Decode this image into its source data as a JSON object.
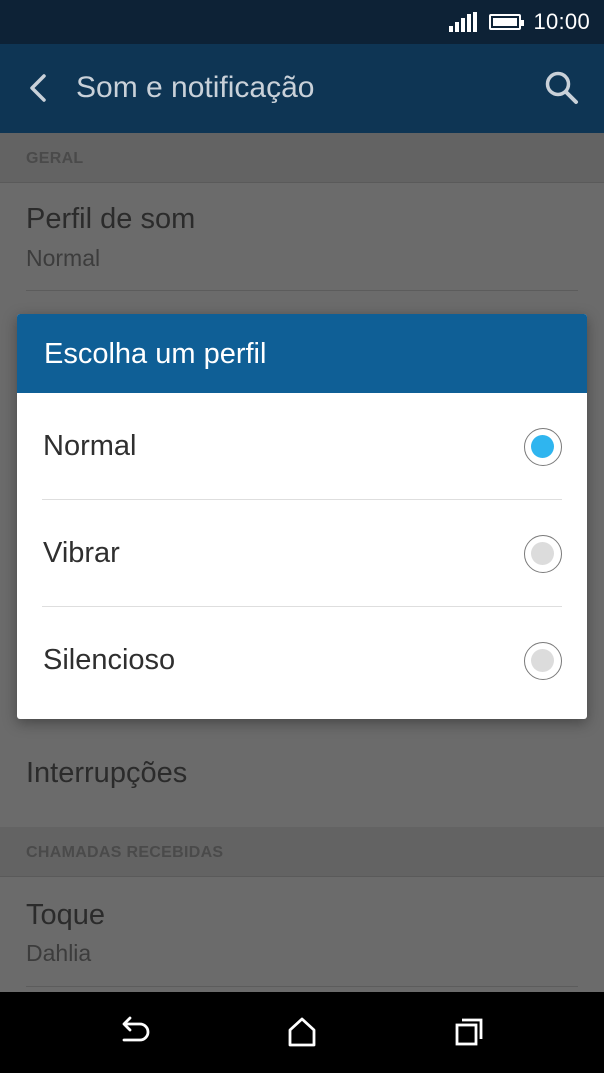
{
  "status_bar": {
    "time": "10:00"
  },
  "app_bar": {
    "title": "Som e notificação"
  },
  "sections": {
    "geral": "GERAL",
    "chamadas": "CHAMADAS RECEBIDAS"
  },
  "items": {
    "perfil": {
      "title": "Perfil de som",
      "value": "Normal"
    },
    "interrupcoes": {
      "title": "Interrupções"
    },
    "toque": {
      "title": "Toque",
      "value": "Dahlia"
    }
  },
  "dialog": {
    "title": "Escolha um perfil",
    "options": [
      {
        "label": "Normal",
        "selected": true
      },
      {
        "label": "Vibrar",
        "selected": false
      },
      {
        "label": "Silencioso",
        "selected": false
      }
    ]
  },
  "colors": {
    "dialog_header": "#0f5f96",
    "radio_selected": "#2fb5ef",
    "app_bar": "#0e3554"
  },
  "icons": {
    "back": "back-arrow-icon",
    "search": "search-icon",
    "nav_back": "back-icon",
    "nav_home": "home-icon",
    "nav_recents": "recents-icon"
  }
}
